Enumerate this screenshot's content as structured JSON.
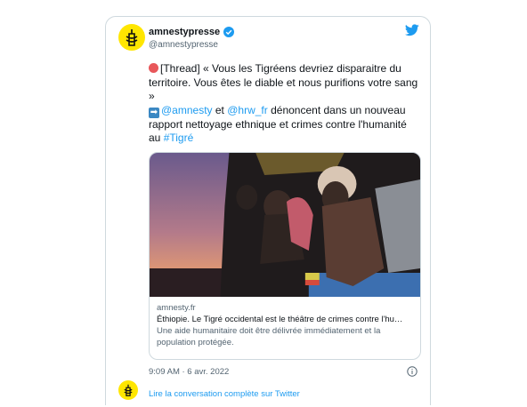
{
  "tweet": {
    "display_name": "amnestypresse",
    "handle": "@amnestypresse",
    "text": {
      "line1_emoji": "red-circle",
      "line1": "[Thread]  « Vous les Tigréens devriez disparaitre du territoire. Vous êtes le diable et nous purifions votre sang »",
      "line2_emoji": "right-arrow",
      "mention1": "@amnesty",
      "connector": " et ",
      "mention2": "@hrw_fr",
      "line2_rest": " dénoncent dans un nouveau rapport nettoyage ethnique et crimes contre l'humanité au ",
      "hashtag": "#Tigré"
    },
    "link_card": {
      "domain": "amnesty.fr",
      "headline": "Éthiopie. Le Tigré occidental est le théâtre de crimes contre l'hu…",
      "description": "Une aide humanitaire doit être délivrée immédiatement et la population protégée."
    },
    "timestamp": "9:09 AM · 6 avr. 2022",
    "read_more": "Lire la conversation complète sur Twitter"
  },
  "colors": {
    "link": "#1d9bf0",
    "avatar_bg": "#ffe600",
    "muted": "#536471"
  },
  "icons": [
    "amnesty-candle-logo",
    "verified-badge-icon",
    "twitter-bird-icon",
    "info-icon"
  ]
}
